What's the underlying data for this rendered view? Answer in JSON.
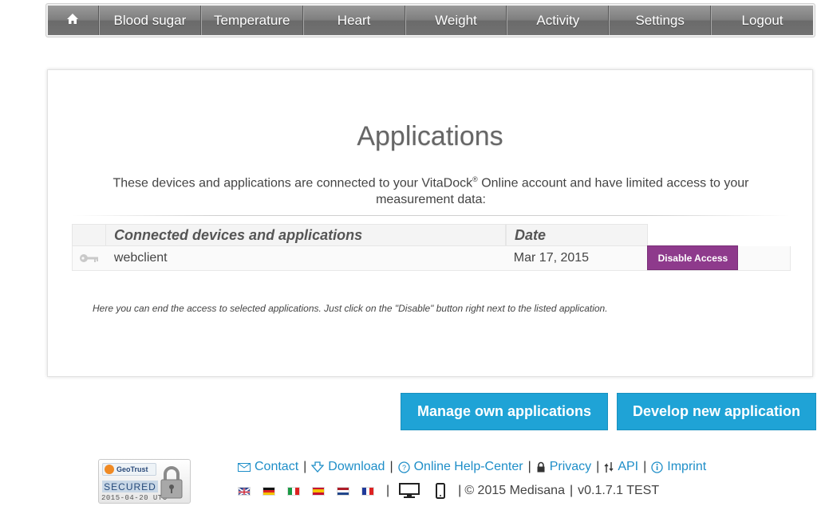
{
  "nav": {
    "home_icon": "home-icon",
    "items": [
      "Blood sugar",
      "Temperature",
      "Heart",
      "Weight",
      "Activity",
      "Settings",
      "Logout"
    ]
  },
  "page": {
    "title": "Applications",
    "description_before": "These devices and applications are connected to your VitaDock",
    "description_reg": "®",
    "description_after": " Online account and have limited access to your measurement data:",
    "hint": "Here you can end the access to selected applications. Just click on the \"Disable\" button right next to the listed application."
  },
  "table": {
    "headers": {
      "name": "Connected devices and applications",
      "date": "Date"
    },
    "rows": [
      {
        "icon": "key-icon",
        "name": "webclient",
        "date": "Mar 17, 2015",
        "action": "Disable Access"
      }
    ]
  },
  "buttons": {
    "manage": "Manage own applications",
    "develop": "Develop new application"
  },
  "footer": {
    "seal": {
      "brand": "GeoTrust",
      "secured": "SECURED",
      "date": "2015-04-20 UTC"
    },
    "links": [
      {
        "label": "Contact",
        "icon": "mail-icon"
      },
      {
        "label": "Download",
        "icon": "download-icon"
      },
      {
        "label": "Online Help-Center",
        "icon": "help-icon"
      },
      {
        "label": "Privacy",
        "icon": "lock-icon"
      },
      {
        "label": "API",
        "icon": "api-icon"
      },
      {
        "label": "Imprint",
        "icon": "info-icon"
      }
    ],
    "languages": [
      "en",
      "de",
      "it",
      "es",
      "nl",
      "fr"
    ],
    "copyright": "© 2015 Medisana",
    "version": "v0.1.7.1 TEST"
  },
  "colors": {
    "accent_blue": "#1fa3d6",
    "disable_purple": "#8e3a8c",
    "link_blue": "#1e8ec8"
  }
}
